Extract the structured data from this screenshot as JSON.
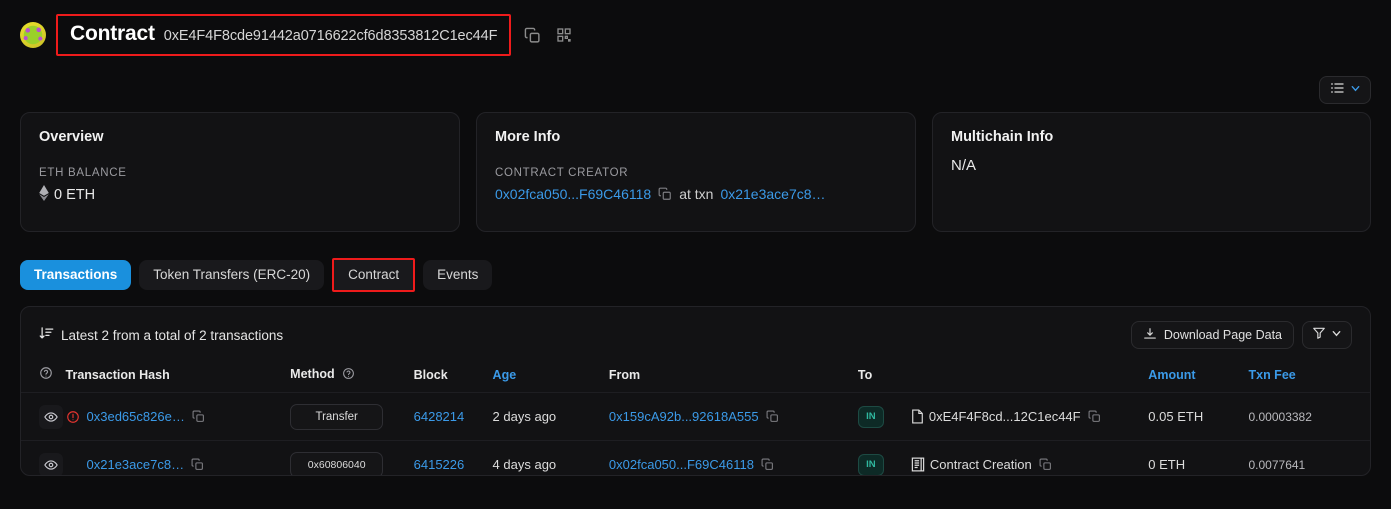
{
  "header": {
    "avatar_icon": "identicon-avatar",
    "label": "Contract",
    "address": "0xE4F4F8cde91442a0716622cf6d8353812C1ec44F",
    "copy_icon": "copy-icon",
    "qr_icon": "qr-code-icon"
  },
  "toolbar": {
    "list_icon": "list-icon",
    "chevron_icon": "chevron-down-icon"
  },
  "cards": {
    "overview": {
      "title": "Overview",
      "label": "ETH BALANCE",
      "eth_icon": "ethereum-icon",
      "value": "0 ETH"
    },
    "more_info": {
      "title": "More Info",
      "label": "CONTRACT CREATOR",
      "creator": "0x02fca050...F69C46118",
      "copy_icon": "copy-icon",
      "at_txn_text": "at txn",
      "txn": "0x21e3ace7c8…"
    },
    "multichain": {
      "title": "Multichain Info",
      "value": "N/A"
    }
  },
  "tabs": [
    {
      "label": "Transactions",
      "active": true,
      "highlighted": false
    },
    {
      "label": "Token Transfers (ERC-20)",
      "active": false,
      "highlighted": false
    },
    {
      "label": "Contract",
      "active": false,
      "highlighted": true
    },
    {
      "label": "Events",
      "active": false,
      "highlighted": false
    }
  ],
  "panel": {
    "sort_icon": "sort-descending-icon",
    "summary": "Latest 2 from a total of 2 transactions",
    "download_icon": "download-icon",
    "download_label": "Download Page Data",
    "filter_icon": "filter-icon",
    "filter_chevron_icon": "chevron-down-icon"
  },
  "table": {
    "columns": [
      {
        "key": "check",
        "label": "",
        "icon": "question-circle-icon",
        "blue": false
      },
      {
        "key": "hash",
        "label": "Transaction Hash",
        "blue": false
      },
      {
        "key": "method",
        "label": "Method",
        "icon": "question-circle-icon",
        "blue": false
      },
      {
        "key": "block",
        "label": "Block",
        "blue": false
      },
      {
        "key": "age",
        "label": "Age",
        "blue": true
      },
      {
        "key": "from",
        "label": "From",
        "blue": false
      },
      {
        "key": "to",
        "label": "To",
        "blue": false
      },
      {
        "key": "amount",
        "label": "Amount",
        "blue": true
      },
      {
        "key": "fee",
        "label": "Txn Fee",
        "blue": true
      }
    ],
    "rows": [
      {
        "eye_icon": "eye-icon",
        "warning_icon": "error-circle-icon",
        "hash": "0x3ed65c826e…",
        "hash_copy_icon": "copy-icon",
        "method": "Transfer",
        "method_is_hex": false,
        "block": "6428214",
        "age": "2 days ago",
        "from": "0x159cA92b...92618A555",
        "from_copy_icon": "copy-icon",
        "direction": "IN",
        "to_icon": "contract-doc-icon",
        "to": "0xE4F4F8cd...12C1ec44F",
        "to_copy_icon": "copy-icon",
        "amount": "0.05 ETH",
        "fee": "0.00003382"
      },
      {
        "eye_icon": "eye-icon",
        "warning_icon": "",
        "hash": "0x21e3ace7c8…",
        "hash_copy_icon": "copy-icon",
        "method": "0x60806040",
        "method_is_hex": true,
        "block": "6415226",
        "age": "4 days ago",
        "from": "0x02fca050...F69C46118",
        "from_copy_icon": "copy-icon",
        "direction": "IN",
        "to_icon": "contract-creation-icon",
        "to": "Contract Creation",
        "to_copy_icon": "copy-icon",
        "amount": "0 ETH",
        "fee": "0.0077641"
      }
    ]
  },
  "colors": {
    "page_bg": "#0c0c0d",
    "card_bg": "#121214",
    "accent_blue": "#3b9ae8",
    "active_tab": "#1a90dd",
    "highlight_red": "#ef1b1b",
    "badge_teal": "#2fb89f",
    "warning_red": "#e2342f"
  }
}
